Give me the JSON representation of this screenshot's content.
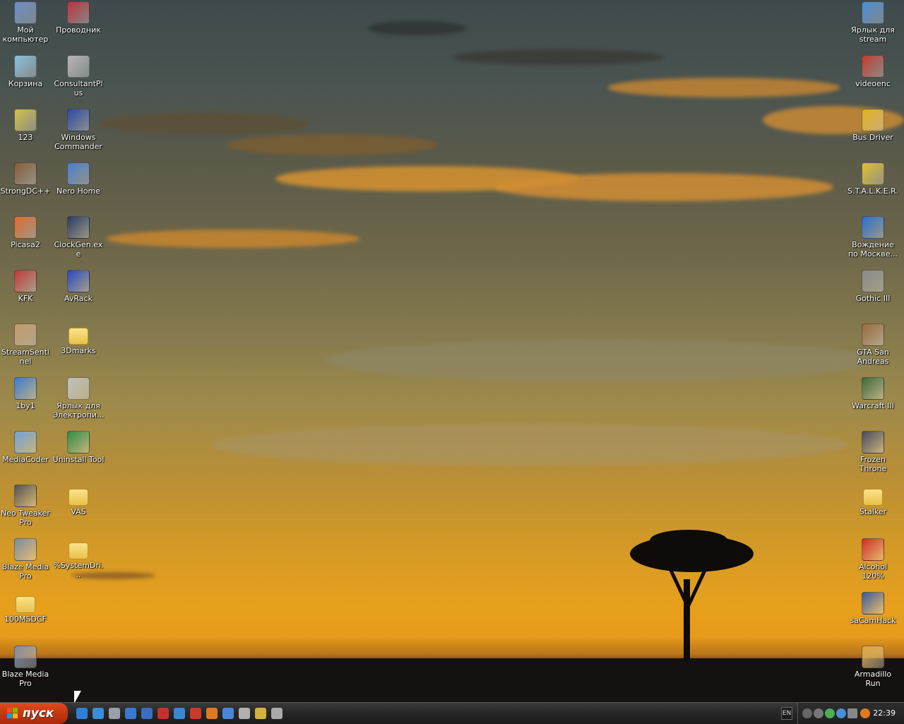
{
  "desktop": {
    "left_col1": [
      {
        "label": "Мой компьютер",
        "icon": "my-computer-icon",
        "color": "#6d8fc9"
      },
      {
        "label": "Корзина",
        "icon": "recycle-bin-icon",
        "color": "#8ac2e0"
      },
      {
        "label": "123",
        "icon": "phone-folder-icon",
        "color": "#d6c04a"
      },
      {
        "label": "StrongDC++",
        "icon": "strongdc-icon",
        "color": "#8a5c3b"
      },
      {
        "label": "Picasa2",
        "icon": "picasa-icon",
        "color": "#e36b2a"
      },
      {
        "label": "KFK",
        "icon": "books-icon",
        "color": "#c43a3a"
      },
      {
        "label": "StreamSentinel",
        "icon": "agent-face-icon",
        "color": "#c79a6a"
      },
      {
        "label": "1by1",
        "icon": "1by1-icon",
        "color": "#3a7bd5"
      },
      {
        "label": "MediaCoder",
        "icon": "mediacoder-icon",
        "color": "#6fa2d8"
      },
      {
        "label": "Neo Tweaker Pro",
        "icon": "dragon-icon",
        "color": "#555555"
      },
      {
        "label": "Blaze Media Pro",
        "icon": "blaze-media-icon",
        "color": "#7c8ca4"
      },
      {
        "label": "100MSDCF",
        "icon": "folder-icon",
        "color": "#f1d06a"
      },
      {
        "label": "Blaze Media Pro",
        "icon": "blaze-media-icon",
        "color": "#7c8ca4"
      }
    ],
    "left_col2": [
      {
        "label": "Проводник",
        "icon": "explorer-icon",
        "color": "#c4313a"
      },
      {
        "label": "ConsultantPlus",
        "icon": "consultant-icon",
        "color": "#b7b7b7"
      },
      {
        "label": "Windows Commander",
        "icon": "floppy-icon",
        "color": "#2c4aa8"
      },
      {
        "label": "Nero Home",
        "icon": "nero-home-icon",
        "color": "#4b7fd1"
      },
      {
        "label": "ClockGen.exe",
        "icon": "clockgen-icon",
        "color": "#2a3c66"
      },
      {
        "label": "AvRack",
        "icon": "avrack-icon",
        "color": "#2a48c8"
      },
      {
        "label": "3Dmarks",
        "icon": "folder-icon",
        "color": "#f1d06a"
      },
      {
        "label": "Ярлык для Электропи...",
        "icon": "shortcut-icon",
        "color": "#c0c0c0"
      },
      {
        "label": "Uninstall Tool",
        "icon": "uninstall-icon",
        "color": "#2d8f45"
      },
      {
        "label": "VAS",
        "icon": "folder-icon",
        "color": "#f1d06a"
      },
      {
        "label": "%SystemDri...",
        "icon": "folder-icon",
        "color": "#f1d06a"
      }
    ],
    "right_col": [
      {
        "label": "Ярлык для stream",
        "icon": "network-icon",
        "color": "#4a8fd8"
      },
      {
        "label": "videoenc",
        "icon": "videoenc-icon",
        "color": "#c63b2b"
      },
      {
        "label": "Bus Driver",
        "icon": "bus-icon",
        "color": "#e0b21a"
      },
      {
        "label": "S.T.A.L.K.E.R.",
        "icon": "radiation-icon",
        "color": "#e3c12b"
      },
      {
        "label": "Вождение по Москве...",
        "icon": "moscow-driving-icon",
        "color": "#2a6fd0"
      },
      {
        "label": "Gothic III",
        "icon": "gothic-icon",
        "color": "#8a8a8a"
      },
      {
        "label": "GTA San Andreas",
        "icon": "gta-icon",
        "color": "#9a6a3a"
      },
      {
        "label": "Warcraft III",
        "icon": "warcraft-icon",
        "color": "#3f6a3a"
      },
      {
        "label": "Frozen Throne",
        "icon": "frozen-throne-icon",
        "color": "#4a4a5a"
      },
      {
        "label": "Stalker",
        "icon": "folder-icon",
        "color": "#f1d06a"
      },
      {
        "label": "Alcohol 120%",
        "icon": "alcohol-icon",
        "color": "#d12a2a"
      },
      {
        "label": "saCamHack",
        "icon": "camera-icon",
        "color": "#3a5a9a"
      },
      {
        "label": "Armadillo Run",
        "icon": "armadillo-icon",
        "color": "#d9a640"
      }
    ]
  },
  "taskbar": {
    "start_label": "пуск",
    "lang": "EN",
    "clock": "22:39",
    "quicklaunch_colors": [
      "#2e7fd8",
      "#3c8dd8",
      "#9aa0a8",
      "#3a78d0",
      "#3a6fc0",
      "#c83030",
      "#3a88d0",
      "#c83a2a",
      "#e07a20",
      "#4a86d8",
      "#b0b0b0",
      "#d2b23a",
      "#aaaaaa"
    ]
  }
}
